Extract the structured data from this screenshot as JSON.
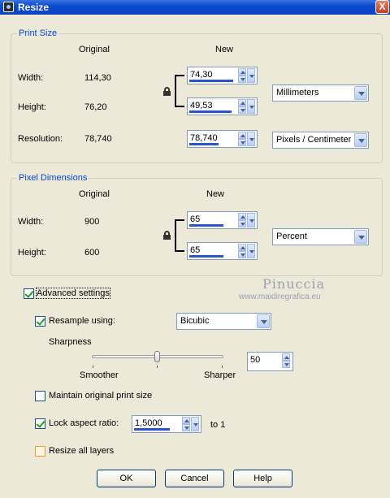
{
  "window": {
    "title": "Resize",
    "close": "X"
  },
  "print_size": {
    "group_title": "Print Size",
    "col_original": "Original",
    "col_new": "New",
    "width_label": "Width:",
    "width_original": "114,30",
    "width_new": "74,30",
    "height_label": "Height:",
    "height_original": "76,20",
    "height_new": "49,53",
    "resolution_label": "Resolution:",
    "resolution_original": "78,740",
    "resolution_new": "78,740",
    "units": "Millimeters",
    "resolution_units": "Pixels / Centimeter"
  },
  "pixel_dimensions": {
    "group_title": "Pixel Dimensions",
    "col_original": "Original",
    "col_new": "New",
    "width_label": "Width:",
    "width_original": "900",
    "width_new": "65",
    "height_label": "Height:",
    "height_original": "600",
    "height_new": "65",
    "units": "Percent"
  },
  "advanced": {
    "label": "Advanced settings",
    "checked": true,
    "resample_label": "Resample using:",
    "resample_checked": true,
    "resample_method": "Bicubic",
    "sharpness_label": "Sharpness",
    "sharpness_value": "50",
    "sharpness_level": 0.5,
    "smoother_label": "Smoother",
    "sharper_label": "Sharper",
    "maintain_label": "Maintain original print size",
    "maintain_checked": false,
    "lock_label": "Lock aspect ratio:",
    "lock_checked": true,
    "aspect_value": "1,5000",
    "aspect_suffix": "to 1",
    "resize_all_label": "Resize all layers",
    "resize_all_checked": false
  },
  "buttons": {
    "ok": "OK",
    "cancel": "Cancel",
    "help": "Help"
  },
  "watermark": {
    "name": "Pinuccia",
    "url": "www.maidiregrafica.eu"
  },
  "colors": {
    "title_bar": "#0a4bd1",
    "group_title": "#0046d5",
    "spin_bar": "#2855c8"
  }
}
